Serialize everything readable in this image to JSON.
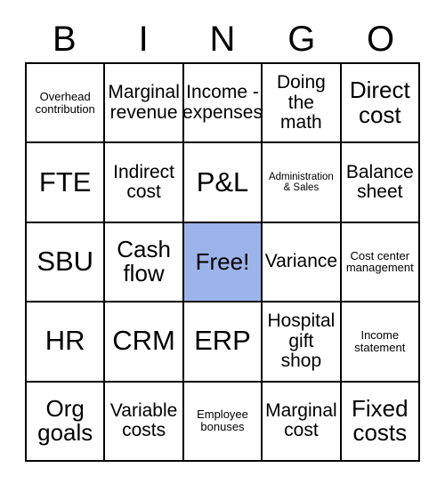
{
  "card": {
    "title": "BINGO",
    "header_letters": [
      "B",
      "I",
      "N",
      "G",
      "O"
    ],
    "free_space_color": "#9cb4e9",
    "border_color": "#000000",
    "background_color": "#ffffff",
    "rows": [
      [
        {
          "label": "Overhead\ncontribution",
          "size": "sm",
          "free": false
        },
        {
          "label": "Marginal\nrevenue",
          "size": "md",
          "free": false
        },
        {
          "label": "Income -\nexpenses",
          "size": "md",
          "free": false
        },
        {
          "label": "Doing\nthe\nmath",
          "size": "md",
          "free": false
        },
        {
          "label": "Direct\ncost",
          "size": "lg",
          "free": false
        }
      ],
      [
        {
          "label": "FTE",
          "size": "xl",
          "free": false
        },
        {
          "label": "Indirect\ncost",
          "size": "md",
          "free": false
        },
        {
          "label": "P&L",
          "size": "xl",
          "free": false
        },
        {
          "label": "Administration\n& Sales",
          "size": "xs",
          "free": false
        },
        {
          "label": "Balance\nsheet",
          "size": "md",
          "free": false
        }
      ],
      [
        {
          "label": "SBU",
          "size": "xl",
          "free": false
        },
        {
          "label": "Cash\nflow",
          "size": "lg",
          "free": false
        },
        {
          "label": "Free!",
          "size": "lg",
          "free": true
        },
        {
          "label": "Variance",
          "size": "md",
          "free": false
        },
        {
          "label": "Cost center\nmanagement",
          "size": "sm",
          "free": false
        }
      ],
      [
        {
          "label": "HR",
          "size": "xl",
          "free": false
        },
        {
          "label": "CRM",
          "size": "xl",
          "free": false
        },
        {
          "label": "ERP",
          "size": "xl",
          "free": false
        },
        {
          "label": "Hospital\ngift\nshop",
          "size": "md",
          "free": false
        },
        {
          "label": "Income\nstatement",
          "size": "sm",
          "free": false
        }
      ],
      [
        {
          "label": "Org\ngoals",
          "size": "lg",
          "free": false
        },
        {
          "label": "Variable\ncosts",
          "size": "md",
          "free": false
        },
        {
          "label": "Employee\nbonuses",
          "size": "sm",
          "free": false
        },
        {
          "label": "Marginal\ncost",
          "size": "md",
          "free": false
        },
        {
          "label": "Fixed\ncosts",
          "size": "lg",
          "free": false
        }
      ]
    ]
  }
}
